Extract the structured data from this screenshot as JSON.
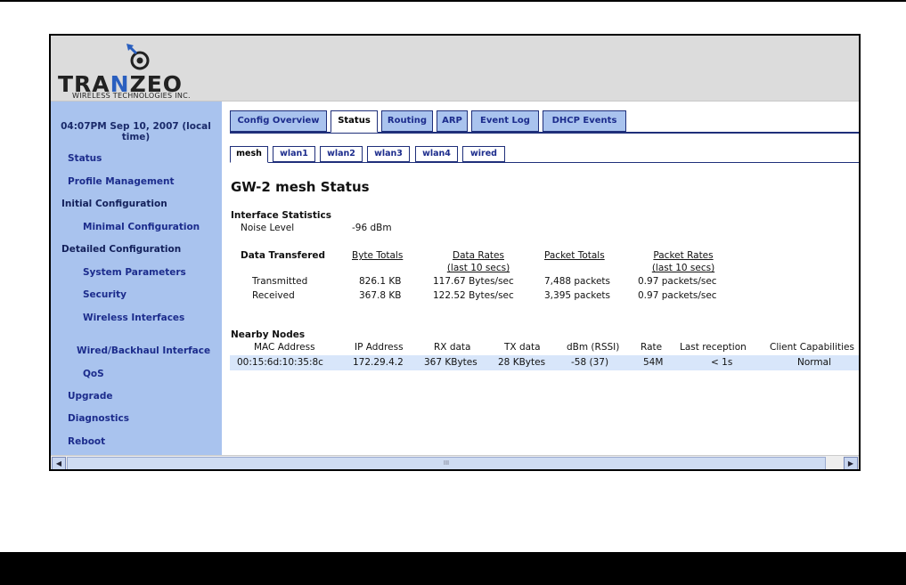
{
  "brand": {
    "name_pre": "TRA",
    "name_hl": "N",
    "name_post": "ZEO",
    "subtitle": "WIRELESS TECHNOLOGIES INC."
  },
  "sidebar": {
    "time": "04:07PM Sep 10, 2007 (local time)",
    "items": [
      {
        "label": "Status"
      },
      {
        "label": "Profile Management"
      },
      {
        "label": "Initial Configuration"
      },
      {
        "label": "Minimal Configuration"
      },
      {
        "label": "Detailed Configuration"
      },
      {
        "label": "System Parameters"
      },
      {
        "label": "Security"
      },
      {
        "label": "Wireless Interfaces"
      },
      {
        "label": "Wired/Backhaul Interface"
      },
      {
        "label": "QoS"
      },
      {
        "label": "Upgrade"
      },
      {
        "label": "Diagnostics"
      },
      {
        "label": "Reboot"
      }
    ]
  },
  "tabs": [
    "Config Overview",
    "Status",
    "Routing",
    "ARP",
    "Event Log",
    "DHCP Events"
  ],
  "subtabs": [
    "mesh",
    "wlan1",
    "wlan2",
    "wlan3",
    "wlan4",
    "wired"
  ],
  "page_title": "GW-2 mesh Status",
  "interface_stats": {
    "heading": "Interface Statistics",
    "noise_label": "Noise Level",
    "noise_value": "-96 dBm",
    "table_label": "Data Transfered",
    "col_byte_totals": "Byte Totals",
    "col_data_rates": "Data Rates",
    "col_data_rates_sub": "(last 10 secs)",
    "col_packet_totals": "Packet Totals",
    "col_packet_rates": "Packet Rates",
    "col_packet_rates_sub": "(last 10 secs)",
    "rows": [
      {
        "label": "Transmitted",
        "bytes": "826.1 KB",
        "rate": "117.67 Bytes/sec",
        "packets": "7,488 packets",
        "prate": "0.97 packets/sec"
      },
      {
        "label": "Received",
        "bytes": "367.8 KB",
        "rate": "122.52 Bytes/sec",
        "packets": "3,395 packets",
        "prate": "0.97 packets/sec"
      }
    ]
  },
  "nearby": {
    "heading": "Nearby Nodes",
    "headers": [
      "MAC Address",
      "IP Address",
      "RX data",
      "TX data",
      "dBm (RSSI)",
      "Rate",
      "Last reception",
      "Client Capabilities"
    ],
    "rows": [
      {
        "mac": "00:15:6d:10:35:8c",
        "ip": "172.29.4.2",
        "rx": "367 KBytes",
        "tx": "28 KBytes",
        "dbm": "-58 (37)",
        "rate": "54M",
        "last": "< 1s",
        "cap": "Normal"
      }
    ]
  },
  "scrollbar": {
    "thumb_grip": "III"
  }
}
